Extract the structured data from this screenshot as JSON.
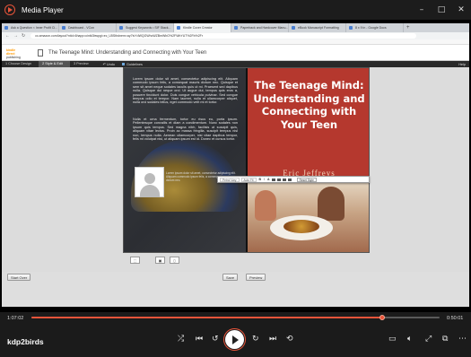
{
  "player": {
    "title": "Media Player",
    "window_buttons": [
      "–",
      "□",
      "✕"
    ],
    "time_elapsed": "1:07:02",
    "time_remaining": "0:50:01",
    "progress": 0.86,
    "channel_name": "kdp2birds",
    "accent": "#e8543a"
  },
  "browser": {
    "tabs": [
      {
        "label": "Ask a Question < Inner Profit Ci..."
      },
      {
        "label": "Dashboard - VCon"
      },
      {
        "label": "Suggest Keywords • SIF Stack..."
      },
      {
        "label": "Kindle Cover Creator"
      },
      {
        "label": "Paperback and Hardcover Manu..."
      },
      {
        "label": "eBook Manuscript Formatting"
      },
      {
        "label": "8 x 9 in - Google Docs"
      }
    ],
    "new_tab": "+",
    "url": "cc.amazon.com/layout?ntid=6happ=cintk3bwpgi=ec_U5Sthdnem=ay7tvYdWQGWhcWZBmWbO%2FWbYUT%2Fb%2Fr"
  },
  "kdp": {
    "logo_top": "kindle direct",
    "logo_bottom": "publishing",
    "page_title": "The Teenage Mind: Understanding and Connecting with Your Teen",
    "steps": [
      "1 Choose Design",
      "2 Style & Edit",
      "3 Preview"
    ],
    "undo": "Undo",
    "guidelines": "Guidelines",
    "help": "Help",
    "start_over": "Start Over",
    "save": "Save",
    "preview": "Preview"
  },
  "cover": {
    "title": "The Teenage Mind: Understanding and Connecting with Your Teen",
    "author": "Eric Jeffreys",
    "back_text_1": "Lorem ipsum dolor sit amet, consectetur adipiscing elit. Aliquam commodo ipsum felis, a consequat mauris dictum nec. Quisque et sem sit amet neque sodales iaculis quis ut mi. Praesent sed dapibus nulla. Quisque dui neque orci. Ut augue dui, tempus quis eros a, posuere tincidunt dolor. Duis congue vehicula pulvinar. Sed congue tempus odio et tempor. Nam laoreet, nulla et ullamcorper aliquet, nulla orci sodales tellus, eget commodo velit mi et tortor.",
    "back_text_2": "Nulla et urna fermentum, tortor eu risus eu, porta ipsum. Pellentesque convallis et diam a condimentum. Nunc sodales non ipsum quis tempus. Sed magna nibh, facilisis ut suscipit quis, aliquam vitae lectus. Proin ac massa fringilla, suscipit tempus nisl non, tempus nulla. Aenean ullamcorper, nisi vitae dapibus tempor, felis mi volutpat nisi, ut aliquam ipsum est id. Donec et cursus tortor.",
    "author_bio": "Lorem ipsum dolor sit amet, consectetur adipiscing elit. Aliquam commodo ipsum felis, a consequat mauris dictum nec."
  },
  "text_toolbar": {
    "font": "Petrol Vary",
    "size": "Auto Fit",
    "bold": "B",
    "italic": "I",
    "color": "A",
    "reset": "Reset Style"
  },
  "thumbs": [
    "⬚",
    "▣",
    "▯"
  ]
}
